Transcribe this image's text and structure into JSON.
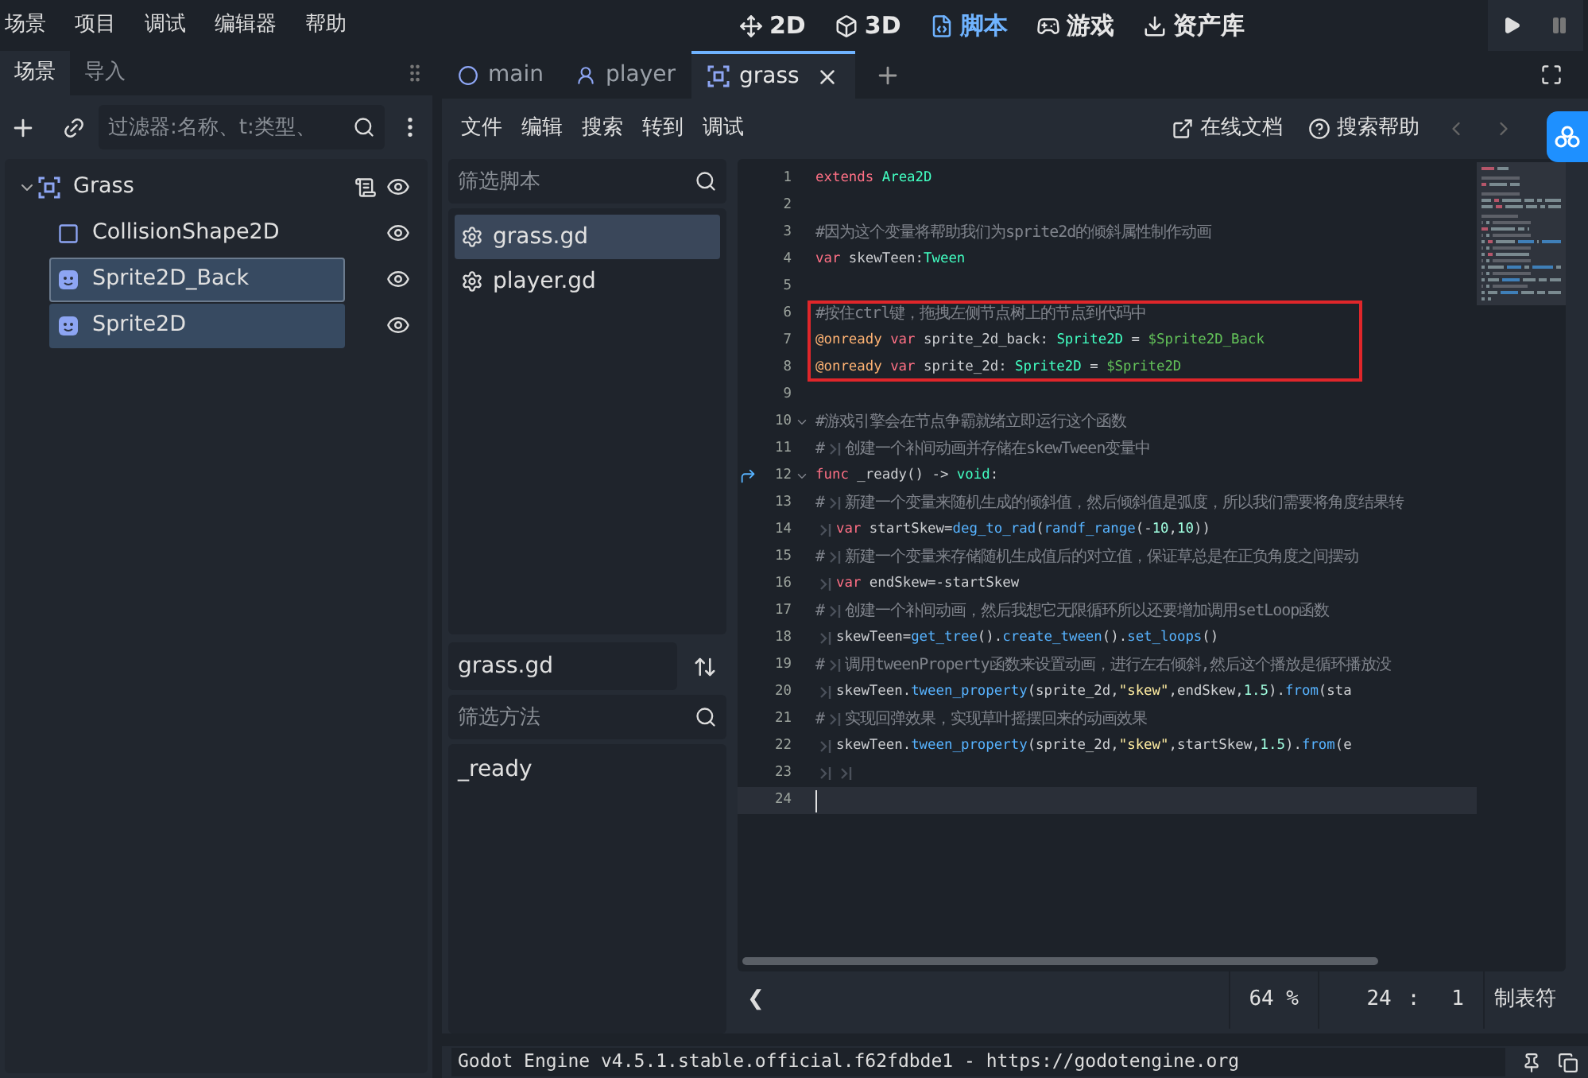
{
  "menu": [
    "场景",
    "项目",
    "调试",
    "编辑器",
    "帮助"
  ],
  "workspaces": [
    {
      "label": "2D",
      "selected": false
    },
    {
      "label": "3D",
      "selected": false
    },
    {
      "label": "脚本",
      "selected": true
    },
    {
      "label": "游戏",
      "selected": false
    },
    {
      "label": "资产库",
      "selected": false
    }
  ],
  "scene_dock": {
    "tabs": [
      {
        "label": "场景",
        "selected": true
      },
      {
        "label": "导入",
        "selected": false
      }
    ],
    "filter": {
      "placeholder": "过滤器:名称、t:类型、"
    },
    "tree": [
      {
        "name": "Grass",
        "kind": "area",
        "expanded": true,
        "selected": false,
        "focused": false,
        "script": true,
        "visible": true,
        "children": [
          {
            "name": "CollisionShape2D",
            "kind": "shape",
            "selected": false,
            "focused": false,
            "script": false,
            "visible": true
          },
          {
            "name": "Sprite2D_Back",
            "kind": "sprite",
            "selected": true,
            "focused": true,
            "script": false,
            "visible": true
          },
          {
            "name": "Sprite2D",
            "kind": "sprite",
            "selected": true,
            "focused": false,
            "script": false,
            "visible": true
          }
        ]
      }
    ]
  },
  "editor_tabs": [
    {
      "label": "main",
      "kind": "circle",
      "selected": false,
      "closable": false
    },
    {
      "label": "player",
      "kind": "character",
      "selected": false,
      "closable": false
    },
    {
      "label": "grass",
      "kind": "area",
      "selected": true,
      "closable": true
    }
  ],
  "script_menu": [
    "文件",
    "编辑",
    "搜索",
    "转到",
    "调试"
  ],
  "help_buttons": [
    "在线文档",
    "搜索帮助"
  ],
  "script_list": {
    "filter": {
      "placeholder": "筛选脚本"
    },
    "items": [
      {
        "name": "grass.gd",
        "selected": true
      },
      {
        "name": "player.gd",
        "selected": false
      }
    ],
    "current": "grass.gd",
    "method_filter": {
      "placeholder": "筛选方法"
    },
    "methods": [
      "_ready"
    ]
  },
  "code": [
    {
      "number": "1",
      "tokens": [
        {
          "kind": "kw",
          "text": "extends"
        },
        {
          "kind": "type",
          "text": " Area2D"
        }
      ]
    },
    {
      "number": "2"
    },
    {
      "number": "3",
      "tokens": [
        {
          "kind": "comment",
          "text": "#因为这个变量将帮助我们为sprite2d的倾斜属性制作动画"
        }
      ]
    },
    {
      "number": "4",
      "tokens": [
        {
          "kind": "kw",
          "text": "var"
        },
        {
          "kind": "plain",
          "text": " skewTeen:"
        },
        {
          "kind": "type",
          "text": "Tween"
        }
      ]
    },
    {
      "number": "5"
    },
    {
      "number": "6",
      "boxed": true,
      "tokens": [
        {
          "kind": "comment",
          "text": "#按住ctrl键，拖拽左侧节点树上的节点到代码中"
        }
      ]
    },
    {
      "number": "7",
      "boxed": true,
      "tokens": [
        {
          "kind": "annot",
          "text": "@onready"
        },
        {
          "kind": "kw",
          "text": " var"
        },
        {
          "kind": "plain",
          "text": " sprite_2d_back: "
        },
        {
          "kind": "type",
          "text": "Sprite2D"
        },
        {
          "kind": "plain",
          "text": " = "
        },
        {
          "kind": "node",
          "text": "$Sprite2D_Back"
        }
      ]
    },
    {
      "number": "8",
      "boxed": true,
      "tokens": [
        {
          "kind": "annot",
          "text": "@onready"
        },
        {
          "kind": "kw",
          "text": " var"
        },
        {
          "kind": "plain",
          "text": " sprite_2d: "
        },
        {
          "kind": "type",
          "text": "Sprite2D"
        },
        {
          "kind": "plain",
          "text": " = "
        },
        {
          "kind": "node",
          "text": "$Sprite2D"
        }
      ]
    },
    {
      "number": "9"
    },
    {
      "number": "10",
      "fold": true,
      "tokens": [
        {
          "kind": "comment",
          "text": "#游戏引擎会在节点争霸就绪立即运行这个函数"
        }
      ]
    },
    {
      "number": "11",
      "tokens": [
        {
          "kind": "comment",
          "text": "#"
        },
        {
          "kind": "tab"
        },
        {
          "kind": "comment",
          "text": "创建一个补间动画并存储在skewTween变量中"
        }
      ]
    },
    {
      "number": "12",
      "fold": true,
      "override": true,
      "tokens": [
        {
          "kind": "kw",
          "text": "func"
        },
        {
          "kind": "plain",
          "text": " _ready() -> "
        },
        {
          "kind": "type",
          "text": "void"
        },
        {
          "kind": "plain",
          "text": ":"
        }
      ]
    },
    {
      "number": "13",
      "tokens": [
        {
          "kind": "comment",
          "text": "#"
        },
        {
          "kind": "tab"
        },
        {
          "kind": "comment",
          "text": "新建一个变量来随机生成的倾斜值，然后倾斜值是弧度，所以我们需要将角度结果转"
        }
      ]
    },
    {
      "number": "14",
      "tokens": [
        {
          "kind": "tab"
        },
        {
          "kind": "kw",
          "text": "var"
        },
        {
          "kind": "plain",
          "text": " startSkew="
        },
        {
          "kind": "fn",
          "text": "deg_to_rad"
        },
        {
          "kind": "plain",
          "text": "("
        },
        {
          "kind": "fn",
          "text": "randf_range"
        },
        {
          "kind": "plain",
          "text": "(-"
        },
        {
          "kind": "num",
          "text": "10"
        },
        {
          "kind": "plain",
          "text": ","
        },
        {
          "kind": "num",
          "text": "10"
        },
        {
          "kind": "plain",
          "text": "))"
        }
      ]
    },
    {
      "number": "15",
      "tokens": [
        {
          "kind": "comment",
          "text": "#"
        },
        {
          "kind": "tab"
        },
        {
          "kind": "comment",
          "text": "新建一个变量来存储随机生成值后的对立值，保证草总是在正负角度之间摆动"
        }
      ]
    },
    {
      "number": "16",
      "tokens": [
        {
          "kind": "tab"
        },
        {
          "kind": "kw",
          "text": "var"
        },
        {
          "kind": "plain",
          "text": " endSkew=-startSkew"
        }
      ]
    },
    {
      "number": "17",
      "tokens": [
        {
          "kind": "comment",
          "text": "#"
        },
        {
          "kind": "tab"
        },
        {
          "kind": "comment",
          "text": "创建一个补间动画，然后我想它无限循环所以还要增加调用setLoop函数"
        }
      ]
    },
    {
      "number": "18",
      "tokens": [
        {
          "kind": "tab"
        },
        {
          "kind": "plain",
          "text": "skewTeen="
        },
        {
          "kind": "fn",
          "text": "get_tree"
        },
        {
          "kind": "plain",
          "text": "()."
        },
        {
          "kind": "fn",
          "text": "create_tween"
        },
        {
          "kind": "plain",
          "text": "()."
        },
        {
          "kind": "fn",
          "text": "set_loops"
        },
        {
          "kind": "plain",
          "text": "()"
        }
      ]
    },
    {
      "number": "19",
      "tokens": [
        {
          "kind": "comment",
          "text": "#"
        },
        {
          "kind": "tab"
        },
        {
          "kind": "comment",
          "text": "调用tweenProperty函数来设置动画，进行左右倾斜,然后这个播放是循环播放没"
        }
      ]
    },
    {
      "number": "20",
      "tokens": [
        {
          "kind": "tab"
        },
        {
          "kind": "plain",
          "text": "skewTeen."
        },
        {
          "kind": "fn",
          "text": "tween_property"
        },
        {
          "kind": "plain",
          "text": "(sprite_2d,"
        },
        {
          "kind": "str",
          "text": "\"skew\""
        },
        {
          "kind": "plain",
          "text": ",endSkew,"
        },
        {
          "kind": "num",
          "text": "1.5"
        },
        {
          "kind": "plain",
          "text": ")."
        },
        {
          "kind": "fn",
          "text": "from"
        },
        {
          "kind": "plain",
          "text": "(sta"
        }
      ]
    },
    {
      "number": "21",
      "tokens": [
        {
          "kind": "comment",
          "text": "#"
        },
        {
          "kind": "tab"
        },
        {
          "kind": "comment",
          "text": "实现回弹效果，实现草叶摇摆回来的动画效果"
        }
      ]
    },
    {
      "number": "22",
      "tokens": [
        {
          "kind": "tab"
        },
        {
          "kind": "plain",
          "text": "skewTeen."
        },
        {
          "kind": "fn",
          "text": "tween_property"
        },
        {
          "kind": "plain",
          "text": "(sprite_2d,"
        },
        {
          "kind": "str",
          "text": "\"skew\""
        },
        {
          "kind": "plain",
          "text": ",startSkew,"
        },
        {
          "kind": "num",
          "text": "1.5"
        },
        {
          "kind": "plain",
          "text": ")."
        },
        {
          "kind": "fn",
          "text": "from"
        },
        {
          "kind": "plain",
          "text": "(e"
        }
      ]
    },
    {
      "number": "23",
      "tokens": [
        {
          "kind": "tab"
        },
        {
          "kind": "tab"
        }
      ]
    },
    {
      "number": "24",
      "current": true
    }
  ],
  "status_bar": {
    "back": "❮",
    "zoom": "64 %",
    "line": "24",
    "separator": ":",
    "column": "1",
    "indent": "制表符"
  },
  "output": {
    "text": "Godot Engine v4.5.1.stable.official.f62fdbde1 - https://godotengine.org"
  }
}
